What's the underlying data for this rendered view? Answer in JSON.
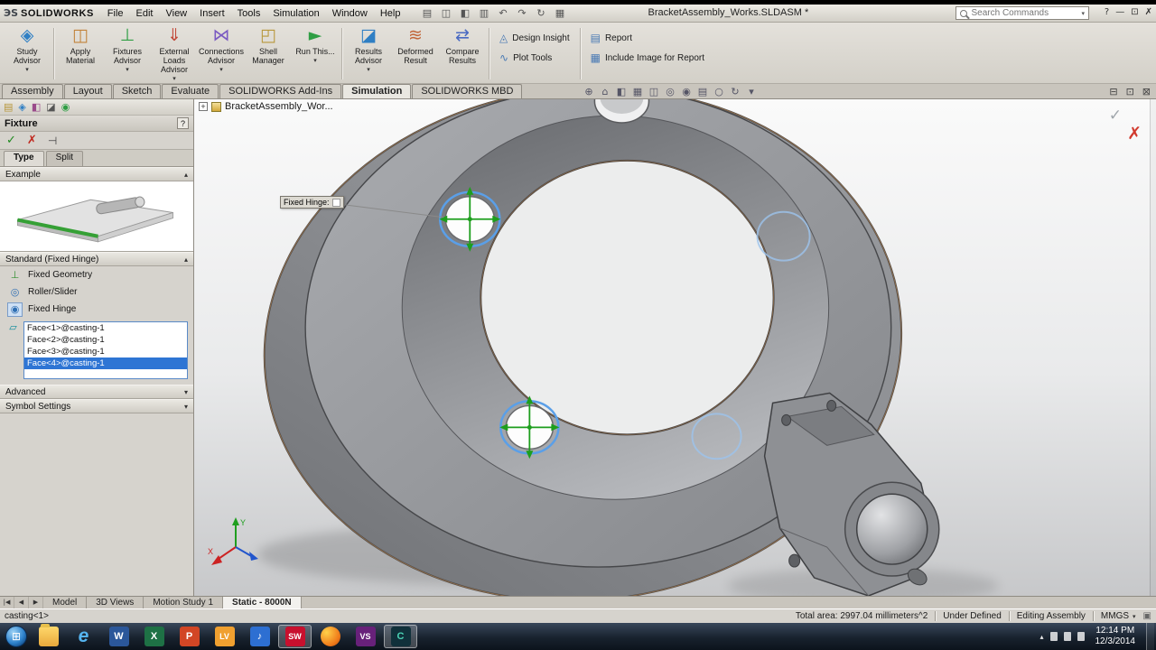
{
  "colors": {
    "selection_blue": "#2e75d4",
    "hinge_highlight_blue": "#5a9fe8",
    "fixture_green": "#1d9e1d",
    "confirm_red": "#d23a2e",
    "part_gray": "#8b8d91"
  },
  "icons": {
    "dropdown": "▾",
    "chevron_up": "▴",
    "chevron_down": "▾",
    "check": "✓",
    "cancel": "✗",
    "pin": "⊣",
    "help": "?",
    "plus": "+",
    "windows": "⊞",
    "minimize": "—",
    "restore": "⊡",
    "doc_min": "⊟",
    "doc_restore": "⊡",
    "doc_close": "⊠",
    "tag": "▣"
  },
  "titlebar": {
    "logo_mark": "ЭS",
    "logo_text": "SOLIDWORKS",
    "menus": [
      "File",
      "Edit",
      "View",
      "Insert",
      "Tools",
      "Simulation",
      "Window",
      "Help"
    ],
    "quick_icons": [
      {
        "name": "new-document",
        "glyph": "▤"
      },
      {
        "name": "open-document",
        "glyph": "◫"
      },
      {
        "name": "save",
        "glyph": "◧"
      },
      {
        "name": "print",
        "glyph": "▥"
      },
      {
        "name": "undo",
        "glyph": "↶"
      },
      {
        "name": "redo",
        "glyph": "↷"
      },
      {
        "name": "rebuild",
        "glyph": "↻"
      },
      {
        "name": "options",
        "glyph": "▦"
      }
    ],
    "title": "BracketAssembly_Works.SLDASM *",
    "search_placeholder": "Search Commands"
  },
  "command_manager": {
    "buttons": [
      {
        "label": "Study Advisor",
        "icon": "◈"
      },
      {
        "label": "Apply Material",
        "icon": "◫"
      },
      {
        "label": "Fixtures Advisor",
        "icon": "⊥"
      },
      {
        "label": "External Loads Advisor",
        "icon": "⇓"
      },
      {
        "label": "Connections Advisor",
        "icon": "⋈"
      },
      {
        "label": "Shell Manager",
        "icon": "◰"
      },
      {
        "label": "Run This...",
        "icon": "►"
      },
      {
        "label": "Results Advisor",
        "icon": "◪"
      },
      {
        "label": "Deformed Result",
        "icon": "≋"
      },
      {
        "label": "Compare Results",
        "icon": "⇄"
      }
    ],
    "links": [
      {
        "label": "Design Insight",
        "icon": "◬"
      },
      {
        "label": "Plot Tools",
        "icon": "∿"
      },
      {
        "label": "Report",
        "icon": "▤"
      },
      {
        "label": "Include Image for Report",
        "icon": "▦"
      }
    ]
  },
  "ribbon_tabs": {
    "items": [
      "Assembly",
      "Layout",
      "Sketch",
      "Evaluate",
      "SOLIDWORKS Add-Ins",
      "Simulation",
      "SOLIDWORKS MBD"
    ],
    "active": "Simulation"
  },
  "property_manager": {
    "title": "Fixture",
    "tool_icons": [
      {
        "name": "feature-manager",
        "glyph": "▤"
      },
      {
        "name": "property-manager",
        "glyph": "◈"
      },
      {
        "name": "configuration-manager",
        "glyph": "◧"
      },
      {
        "name": "dimxpert-manager",
        "glyph": "◪"
      },
      {
        "name": "display-manager",
        "glyph": "◉"
      }
    ],
    "tabs": [
      "Type",
      "Split"
    ],
    "sections": {
      "example_title": "Example",
      "standard_title": "Standard (Fixed Hinge)",
      "advanced_title": "Advanced",
      "symbol_title": "Symbol Settings"
    },
    "options": [
      {
        "label": "Fixed Geometry",
        "icon": "⊥"
      },
      {
        "label": "Roller/Slider",
        "icon": "◎"
      },
      {
        "label": "Fixed Hinge",
        "icon": "◉"
      }
    ],
    "selections": [
      "Face<1>@casting-1",
      "Face<2>@casting-1",
      "Face<3>@casting-1",
      "Face<4>@casting-1"
    ],
    "selected_item": "Face<4>@casting-1"
  },
  "viewport": {
    "feature_tree_label": "BracketAssembly_Wor...",
    "callout_label": "Fixed Hinge: ",
    "hud": [
      {
        "name": "zoom-area",
        "glyph": "⊕"
      },
      {
        "name": "zoom-fit",
        "glyph": "⌂"
      },
      {
        "name": "section-view",
        "glyph": "◧"
      },
      {
        "name": "view-orientation",
        "glyph": "▦"
      },
      {
        "name": "display-style",
        "glyph": "◫"
      },
      {
        "name": "hide-show-items",
        "glyph": "◎"
      },
      {
        "name": "edit-appearance",
        "glyph": "◉"
      },
      {
        "name": "apply-scene",
        "glyph": "▤"
      },
      {
        "name": "view-settings",
        "glyph": "○"
      },
      {
        "name": "rotate-view",
        "glyph": "↻"
      },
      {
        "name": "more-options",
        "glyph": "▾"
      }
    ],
    "triad": {
      "x": "X",
      "y": "Y"
    }
  },
  "bottom_tabs": {
    "nav": [
      "|◀",
      "◀",
      "▶"
    ],
    "items": [
      "Model",
      "3D Views",
      "Motion Study 1",
      "Static - 8000N"
    ],
    "active": "Static - 8000N"
  },
  "status_bar": {
    "selection": "casting<1>",
    "area": "Total area: 2997.04 millimeters^2",
    "constraint_state": "Under Defined",
    "mode": "Editing Assembly",
    "units": "MMGS"
  },
  "taskbar": {
    "icons": [
      {
        "name": "windows-explorer"
      },
      {
        "name": "internet-explorer",
        "glyph": "e"
      },
      {
        "name": "word",
        "glyph": "W"
      },
      {
        "name": "excel",
        "glyph": "X"
      },
      {
        "name": "powerpoint",
        "glyph": "P"
      },
      {
        "name": "labview",
        "glyph": "LV"
      },
      {
        "name": "media-player",
        "glyph": "♪"
      },
      {
        "name": "solidworks",
        "glyph": "SW"
      },
      {
        "name": "firefox"
      },
      {
        "name": "visual-studio",
        "glyph": "VS"
      },
      {
        "name": "camtasia",
        "glyph": "C"
      }
    ],
    "clock_time": "12:14 PM",
    "clock_date": "12/3/2014"
  }
}
